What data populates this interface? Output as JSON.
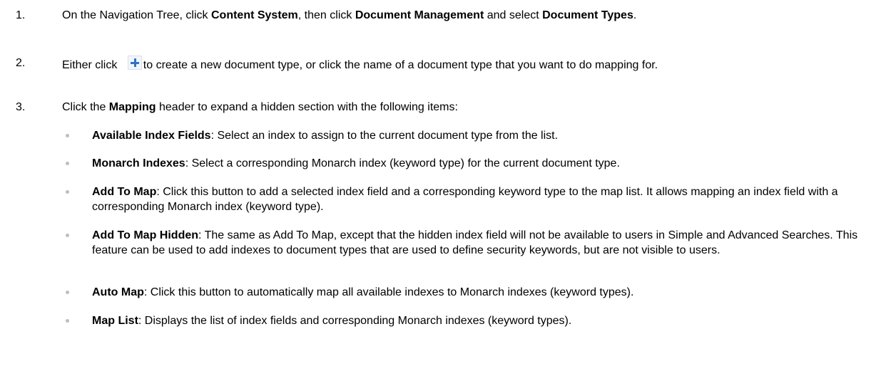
{
  "steps": [
    {
      "num": "1.",
      "parts": [
        {
          "t": "On the Navigation Tree, click "
        },
        {
          "t": "Content System",
          "b": true
        },
        {
          "t": ", then click "
        },
        {
          "t": "Document Management",
          "b": true
        },
        {
          "t": " and select "
        },
        {
          "t": "Document Types",
          "b": true
        },
        {
          "t": "."
        }
      ]
    },
    {
      "num": "2.",
      "parts": [
        {
          "t": "Either click "
        },
        {
          "icon": "plus-icon"
        },
        {
          "t": "to create a new document type, or click the name of a document type that you want to do mapping for."
        }
      ]
    },
    {
      "num": "3.",
      "parts": [
        {
          "t": "Click the "
        },
        {
          "t": "Mapping",
          "b": true
        },
        {
          "t": " header to expand a hidden section with the following items:"
        }
      ]
    }
  ],
  "items": [
    {
      "term": "Available Index Fields",
      "desc": ": Select an index to assign to the current document type from the list."
    },
    {
      "term": "Monarch Indexes",
      "desc": ": Select a corresponding Monarch index (keyword type) for the current document type."
    },
    {
      "term": "Add To Map",
      "desc": ": Click this button to add a selected index field and a corresponding keyword type to the map list. It allows mapping an index field with a corresponding Monarch index (keyword type)."
    },
    {
      "term": "Add To Map Hidden",
      "desc": ": The same as Add To Map, except that the hidden index field will not be available to users in Simple and Advanced Searches. This feature can be used to add indexes to document types that are used to define security keywords, but are not visible to users."
    },
    {
      "term": "Auto Map",
      "desc": ": Click this button to automatically map all available indexes to Monarch indexes (keyword types)."
    },
    {
      "term": "Map List",
      "desc": ": Displays the list of index fields and corresponding Monarch indexes (keyword types)."
    }
  ],
  "icons": {
    "plus": "plus-icon"
  },
  "colors": {
    "text": "#000000",
    "icon_plus": "#2f73c6",
    "bullet": "#bdbdbd"
  }
}
